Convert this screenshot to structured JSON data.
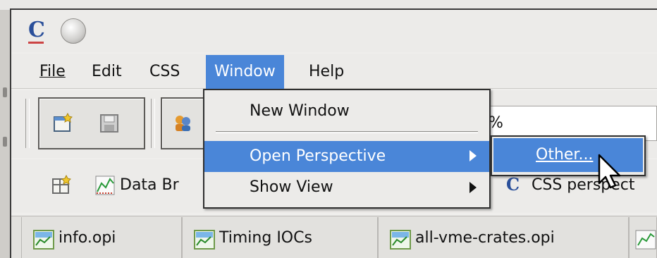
{
  "menubar": {
    "items": [
      {
        "label": "File"
      },
      {
        "label": "Edit"
      },
      {
        "label": "CSS"
      },
      {
        "label": "Window"
      },
      {
        "label": "Help"
      }
    ]
  },
  "window_menu": {
    "items": [
      {
        "label": "New Window"
      },
      {
        "label": "Open Perspective"
      },
      {
        "label": "Show View"
      }
    ]
  },
  "submenu": {
    "items": [
      {
        "label": "Other..."
      }
    ]
  },
  "toolbar": {
    "path_text": "%"
  },
  "perspectives": {
    "data_browser": "Data Br",
    "css_perspective": "CSS perspect"
  },
  "editor_tabs": [
    {
      "label": "info.opi"
    },
    {
      "label": "Timing IOCs"
    },
    {
      "label": "all-vme-crates.opi"
    }
  ],
  "colors": {
    "menu_highlight": "#4a86d8",
    "window_bg": "#efeeec"
  },
  "icons": [
    "app-logo-icon",
    "new-window-icon",
    "save-icon",
    "team-icon",
    "open-perspective-icon",
    "data-browser-icon",
    "css-perspective-icon",
    "opi-file-icon",
    "submenu-arrow-icon",
    "mouse-pointer-icon"
  ]
}
